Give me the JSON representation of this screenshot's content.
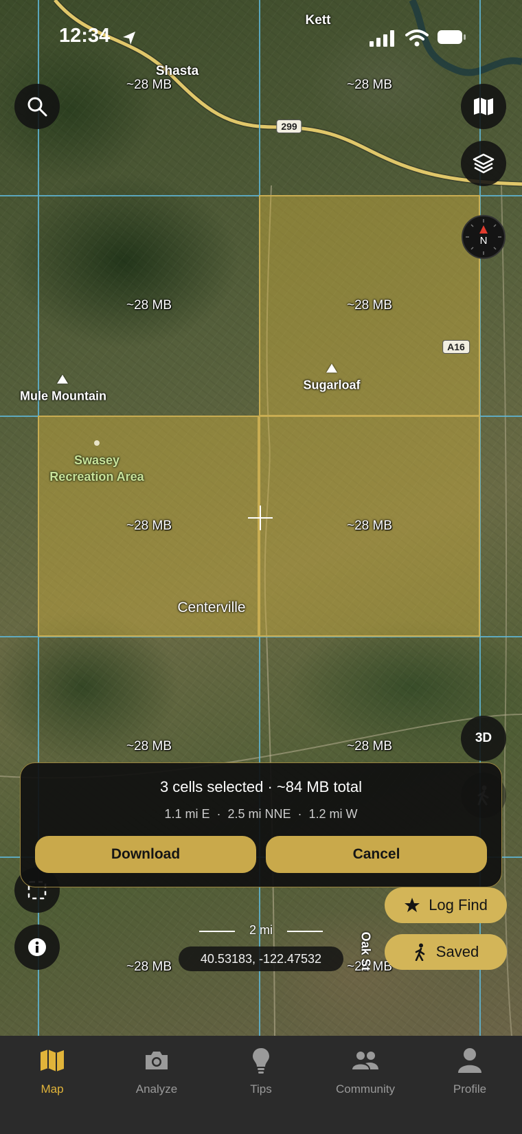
{
  "status_bar": {
    "time": "12:34"
  },
  "map": {
    "places": {
      "kett": "Kett",
      "shasta": "Shasta",
      "mule_mountain": "Mule Mountain",
      "sugarloaf": "Sugarloaf",
      "swasey": "Swasey\nRecreation Area",
      "centerville": "Centerville",
      "oak_st": "Oak St"
    },
    "shields": {
      "hwy299": "299",
      "a16": "A16"
    },
    "cell_size_label": "~28 MB"
  },
  "controls": {
    "three_d_label": "3D"
  },
  "selection_panel": {
    "title": "3 cells selected · ~84 MB total",
    "distances": "1.1 mi E  ·  2.5 mi NNE  ·  1.2 mi W",
    "download_label": "Download",
    "cancel_label": "Cancel"
  },
  "actions": {
    "log_find_label": "Log Find",
    "saved_label": "Saved"
  },
  "scale_bar": {
    "label": "2 mi"
  },
  "coordinates": "40.53183, -122.47532",
  "tab_bar": {
    "tabs": [
      {
        "label": "Map",
        "icon": "map-icon",
        "active": true
      },
      {
        "label": "Analyze",
        "icon": "camera-icon",
        "active": false
      },
      {
        "label": "Tips",
        "icon": "lightbulb-icon",
        "active": false
      },
      {
        "label": "Community",
        "icon": "people-icon",
        "active": false
      },
      {
        "label": "Profile",
        "icon": "person-icon",
        "active": false
      }
    ]
  },
  "colors": {
    "accent": "#c9a94b",
    "active_tab": "#e1b43a",
    "grid": "#5fb6d6",
    "selection": "#c9ad52"
  }
}
